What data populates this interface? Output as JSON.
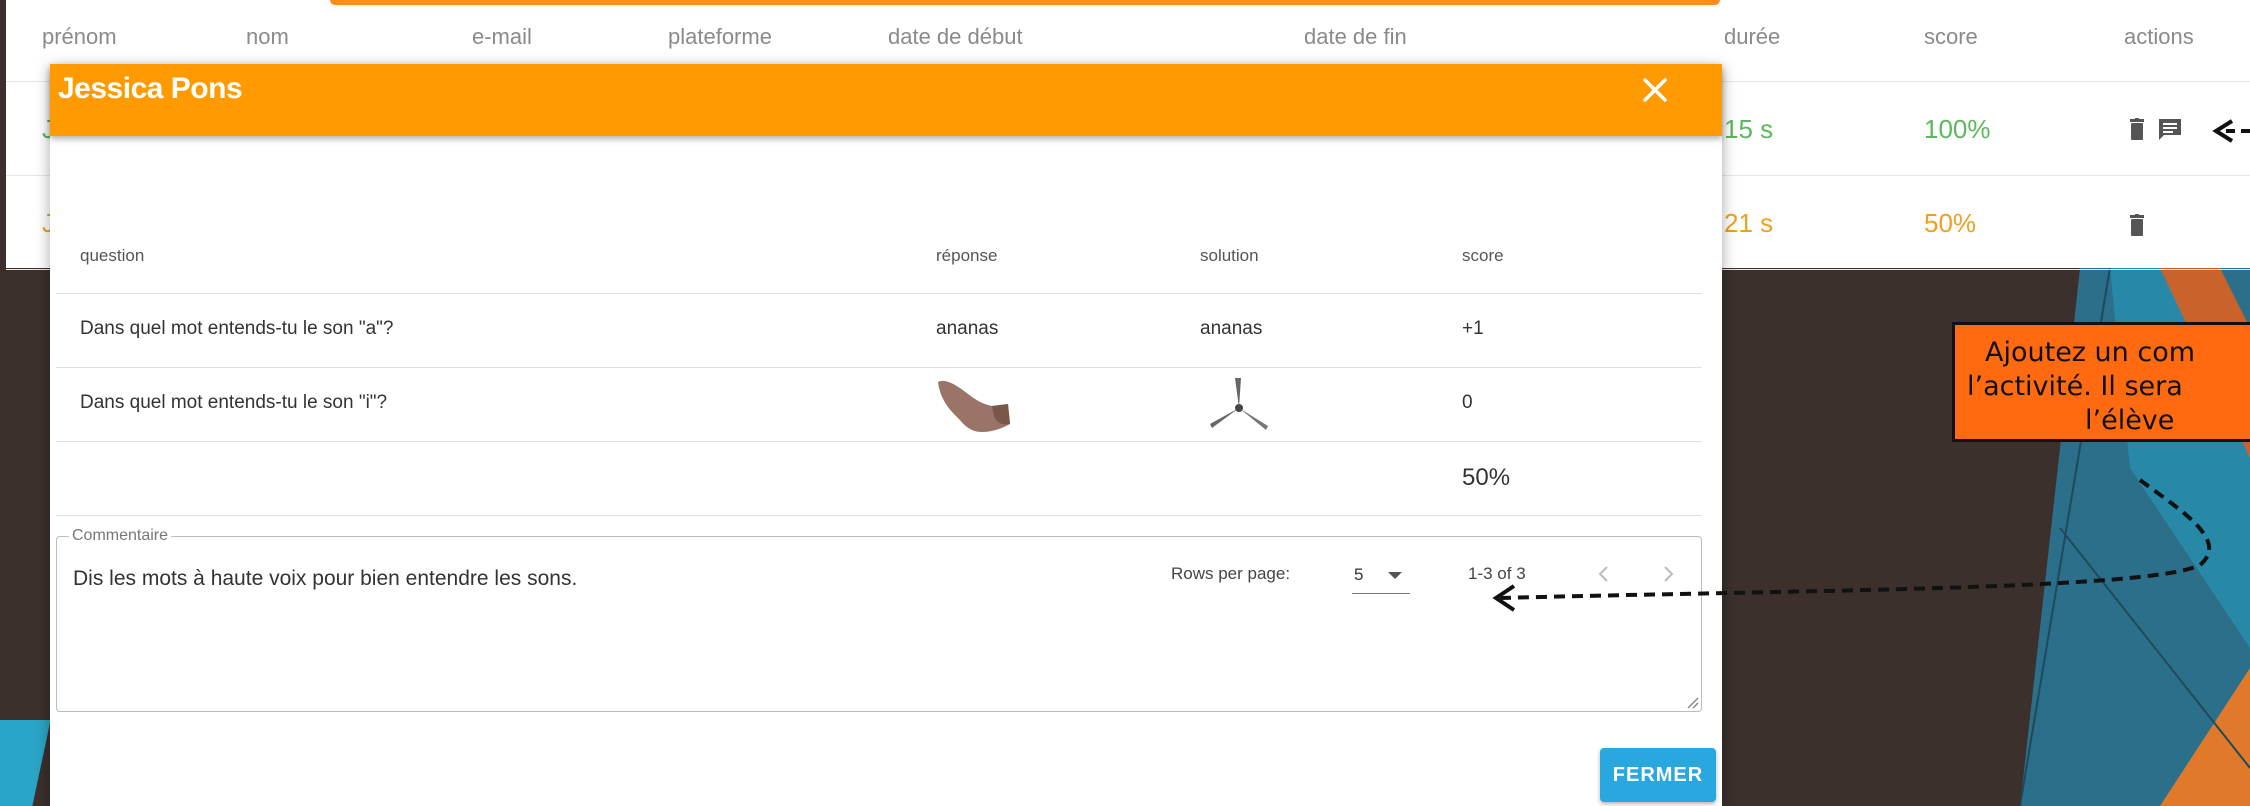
{
  "base_table": {
    "headers": {
      "prenom": "prénom",
      "nom": "nom",
      "email": "e-mail",
      "plateforme": "plateforme",
      "date_debut": "date de début",
      "date_fin": "date de fin",
      "duree": "durée",
      "score": "score",
      "actions": "actions"
    },
    "rows": [
      {
        "initial": "J",
        "duree": "15 s",
        "score": "100%",
        "icons": [
          "trash-icon",
          "comment-icon"
        ]
      },
      {
        "initial": "J",
        "duree": "21 s",
        "score": "50%",
        "icons": [
          "trash-icon"
        ]
      }
    ]
  },
  "modal": {
    "title": "Jessica Pons",
    "close_icon": "close-icon",
    "columns": {
      "question": "question",
      "reponse": "réponse",
      "solution": "solution",
      "score": "score"
    },
    "rows": [
      {
        "question": "Dans quel mot entends-tu le son \"a\"?",
        "reponse": "ananas",
        "solution": "ananas",
        "score": "+1"
      },
      {
        "question": "Dans quel mot entends-tu le son \"i\"?",
        "reponse_image": "foot-image",
        "solution_image": "propeller-image",
        "score": "0"
      }
    ],
    "total_score": "50%",
    "pagination": {
      "rows_per_page_label": "Rows per page:",
      "rows_per_page_value": "5",
      "range": "1-3 of 3"
    },
    "comment": {
      "label": "Commentaire",
      "value": "Dis les mots à haute voix pour bien entendre les sons."
    },
    "close_button_label": "FERMER"
  },
  "callout": {
    "lines": [
      "Ajoutez un com",
      "l’activité. Il sera",
      "l’élève"
    ]
  },
  "colors": {
    "modal_header": "#ff9a00",
    "callout_bg": "#ff6a10",
    "button_blue": "#29a8df",
    "correct_green": "#3cae45",
    "answer_blue": "#2aa5d8",
    "wrong_red": "#f04848",
    "score_orange": "#ffa000"
  }
}
